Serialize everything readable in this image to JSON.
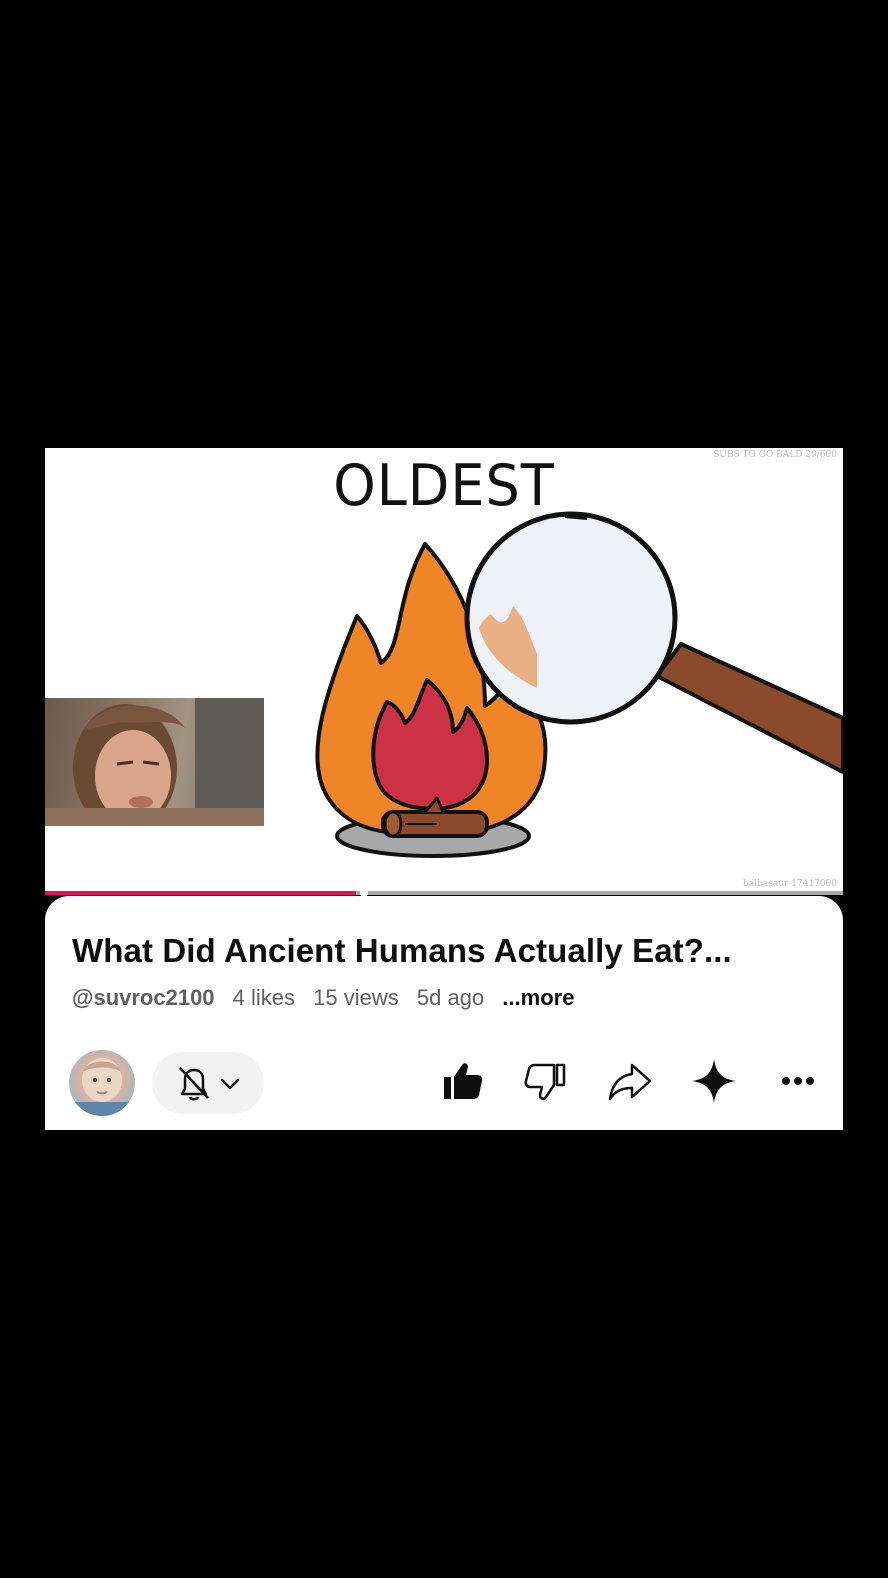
{
  "video": {
    "drawing_title": "OLDEST",
    "watermark_top": "SUBS TO GO BALD 29/600",
    "watermark_bottom": "balbasaur 17417000",
    "progress_fraction": 0.39
  },
  "info": {
    "title": "What Did Ancient Humans Actually Eat?...",
    "channel": "@suvroc2100",
    "likes": "4 likes",
    "views": "15 views",
    "age": "5d ago",
    "more": "...more"
  },
  "actions": {
    "subscription_icon": "bell-off-icon",
    "items": [
      "like-icon",
      "dislike-icon",
      "share-icon",
      "remix-icon",
      "more-options-icon"
    ]
  },
  "colors": {
    "progress_fill": "#e0115f",
    "background": "#000000",
    "card": "#ffffff"
  }
}
